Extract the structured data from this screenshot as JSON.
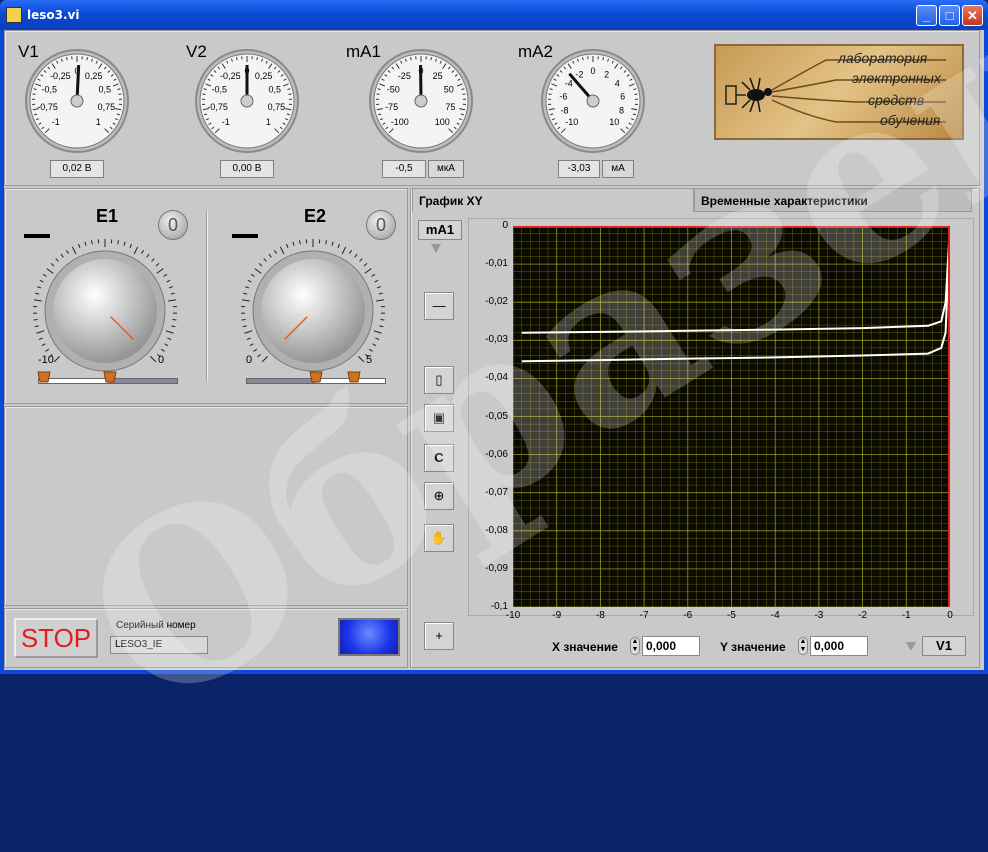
{
  "window": {
    "title": "leso3.vi",
    "minimize": "_",
    "maximize": "□",
    "close": "✕"
  },
  "meters": [
    {
      "label": "V1",
      "ticks": [
        "0",
        "0,25",
        "0,5",
        "0,75",
        "1",
        "-1",
        "-0,75",
        "-0,5",
        "-0,25"
      ],
      "value": 0.02,
      "readout": "0,02 В",
      "unit": ""
    },
    {
      "label": "V2",
      "ticks": [
        "0",
        "0,25",
        "0,5",
        "0,75",
        "1",
        "-1",
        "-0,75",
        "-0,5",
        "-0,25"
      ],
      "value": 0.0,
      "readout": "0,00 В",
      "unit": ""
    },
    {
      "label": "mA1",
      "ticks": [
        "0",
        "25",
        "50",
        "75",
        "100",
        "-100",
        "-75",
        "-50",
        "-25"
      ],
      "value": -0.5,
      "readout": "-0,5",
      "unit": "мкА"
    },
    {
      "label": "mA2",
      "ticks": [
        "0",
        "2",
        "4",
        "6",
        "8",
        "10",
        "-10",
        "-8",
        "-6",
        "-4",
        "-2"
      ],
      "value": -3.03,
      "readout": "-3,03",
      "unit": "мА"
    }
  ],
  "logo": {
    "lines": [
      "лаборатория",
      "электронных",
      "средств",
      "обучения"
    ]
  },
  "sources": [
    {
      "title": "E1",
      "zero": "0",
      "min": "-10",
      "max": "0"
    },
    {
      "title": "E2",
      "zero": "0",
      "min": "0",
      "max": "5"
    }
  ],
  "controls": {
    "stop": "STOP",
    "serial_label": "Серийный номер",
    "serial_value": "LESO3_IE"
  },
  "tabs": {
    "xy": "График XY",
    "time": "Временные характеристики"
  },
  "graph": {
    "y_channel": "mA1",
    "x_channel": "V1",
    "x_label_text": "X значение",
    "y_label_text": "Y значение",
    "x_value": "0,000",
    "y_value": "0,000",
    "tool_c": "C",
    "y_ticks": [
      "0",
      "-0,01",
      "-0,02",
      "-0,03",
      "-0,04",
      "-0,05",
      "-0,06",
      "-0,07",
      "-0,08",
      "-0,09",
      "-0,1"
    ],
    "x_ticks": [
      "-10",
      "-9",
      "-8",
      "-7",
      "-6",
      "-5",
      "-4",
      "-3",
      "-2",
      "-1",
      "0"
    ]
  },
  "chart_data": {
    "type": "line",
    "xlim": [
      -10,
      0
    ],
    "ylim": [
      -0.1,
      0
    ],
    "grid": true,
    "series": [
      {
        "x": [
          -9.8,
          -8,
          -6,
          -4,
          -2,
          -0.5,
          -0.2,
          -0.1,
          0
        ],
        "y": [
          -0.028,
          -0.0278,
          -0.0275,
          -0.0272,
          -0.0268,
          -0.0262,
          -0.025,
          -0.02,
          0
        ]
      },
      {
        "x": [
          -9.8,
          -8,
          -6,
          -4,
          -2,
          -0.5,
          -0.2,
          -0.1,
          0
        ],
        "y": [
          -0.0355,
          -0.0352,
          -0.0348,
          -0.0345,
          -0.034,
          -0.0335,
          -0.032,
          -0.028,
          0
        ]
      }
    ],
    "colors": {
      "background": "#0b0b00",
      "grid": "#b8b820",
      "line": "#ffffff",
      "cursor": "#e02020"
    }
  },
  "watermark": "Образец"
}
